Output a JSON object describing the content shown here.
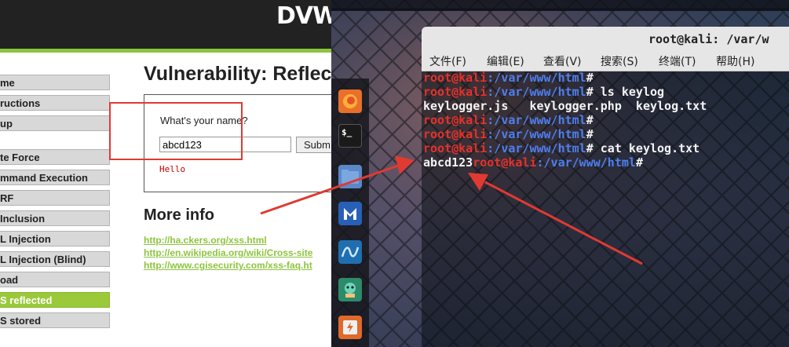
{
  "dvwa": {
    "logo": "DVWA",
    "menu": [
      {
        "label": "me",
        "active": false
      },
      {
        "label": "ructions",
        "active": false
      },
      {
        "label": "up",
        "active": false
      },
      {
        "label": "te Force",
        "active": false
      },
      {
        "label": "mmand Execution",
        "active": false
      },
      {
        "label": "RF",
        "active": false
      },
      {
        "label": "Inclusion",
        "active": false
      },
      {
        "label": "L Injection",
        "active": false
      },
      {
        "label": "L Injection (Blind)",
        "active": false
      },
      {
        "label": "oad",
        "active": false
      },
      {
        "label": "S reflected",
        "active": true
      },
      {
        "label": "S stored",
        "active": false
      }
    ],
    "page_title": "Vulnerability: Reflec",
    "form": {
      "label": "What's your name?",
      "input_value": "abcd123",
      "submit_label": "Subm",
      "output": "Hello"
    },
    "more_info_title": "More info",
    "links": [
      "http://ha.ckers.org/xss.html",
      "http://en.wikipedia.org/wiki/Cross-site",
      "http://www.cgisecurity.com/xss-faq.ht"
    ]
  },
  "terminal": {
    "title": "root@kali: /var/w",
    "menu": [
      "文件(F)",
      "编辑(E)",
      "查看(V)",
      "搜索(S)",
      "终端(T)",
      "帮助(H)"
    ],
    "prompt_user": "root@kali",
    "prompt_path": ":/var/www/html",
    "prompt_symbol": "#",
    "commands": {
      "line2": " ls keylog",
      "line3_output": "keylogger.js   keylogger.php  keylog.txt",
      "line6": " cat keylog.txt",
      "line7_output": "abcd123"
    }
  },
  "dock": {
    "icons": [
      "firefox-icon",
      "terminal-icon",
      "files-icon",
      "metasploit-icon",
      "armitage-icon",
      "maltego-icon",
      "burpsuite-icon"
    ],
    "terminal_glyph": "$_"
  },
  "colors": {
    "dvwa_green": "#8dc53e",
    "prompt_red": "#e5322b",
    "prompt_blue": "#4f7ff0",
    "annotation_red": "#e03a32"
  }
}
